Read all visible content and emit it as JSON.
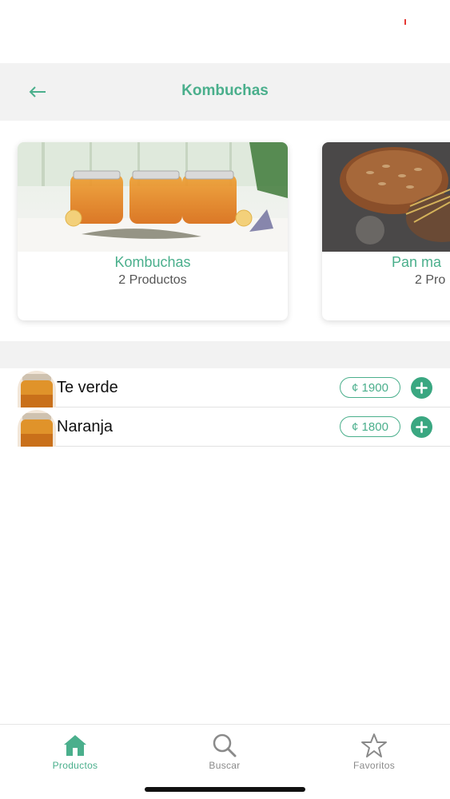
{
  "header": {
    "title": "Kombuchas",
    "back_icon": "arrow-left-icon"
  },
  "categories": [
    {
      "name": "Kombuchas",
      "count": "2 Productos",
      "image": "kombucha-jars-photo"
    },
    {
      "name": "Pan ma",
      "count": "2 Pro",
      "image": "bread-photo"
    }
  ],
  "products": [
    {
      "name": "Te verde",
      "price": "¢ 1900",
      "image": "kombucha-jar-thumb"
    },
    {
      "name": "Naranja",
      "price": "¢ 1800",
      "image": "kombucha-jar-thumb"
    }
  ],
  "tabs": [
    {
      "label": "Productos",
      "icon": "home-icon",
      "active": true
    },
    {
      "label": "Buscar",
      "icon": "search-icon",
      "active": false
    },
    {
      "label": "Favoritos",
      "icon": "star-icon",
      "active": false
    }
  ],
  "colors": {
    "accent": "#4aaf8c",
    "add_button": "#3aa781",
    "band": "#f2f2f2"
  }
}
